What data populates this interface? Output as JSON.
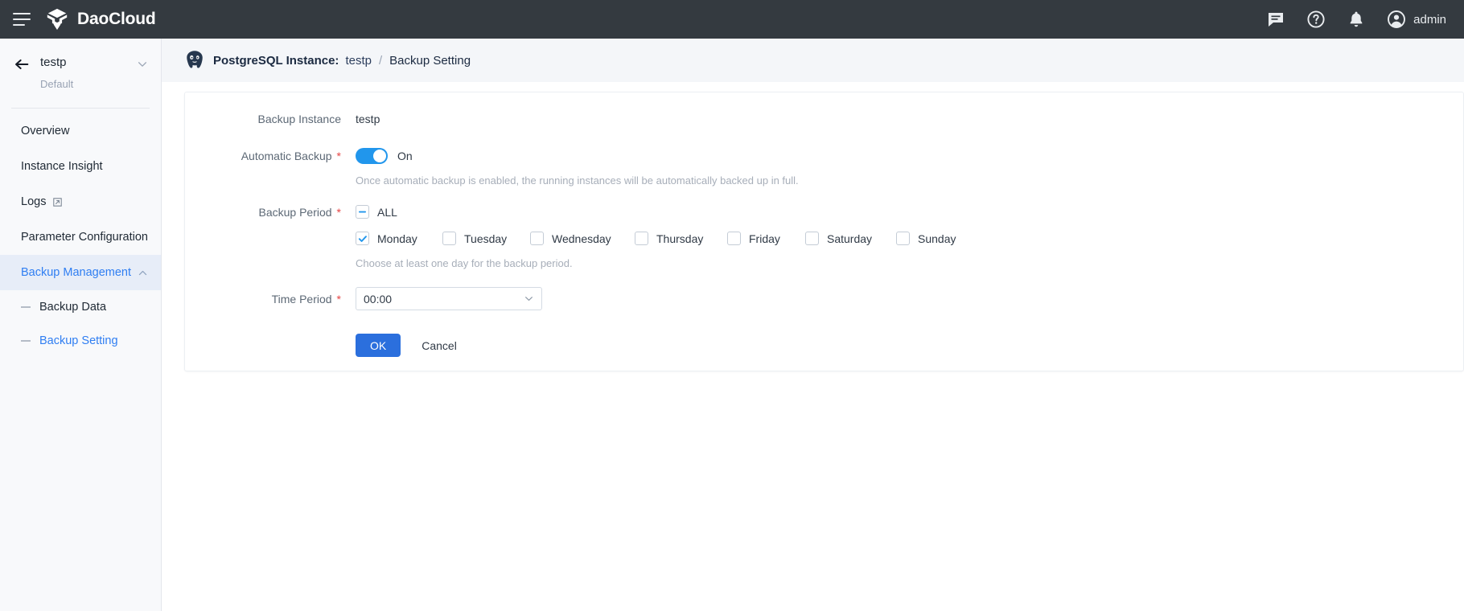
{
  "topbar": {
    "menu_icon": "hamburger-icon",
    "brand": "DaoCloud",
    "icons": [
      "message-icon",
      "help-icon",
      "bell-icon"
    ],
    "user": "admin",
    "background": "#343a40"
  },
  "sidebar": {
    "back_icon": "back-arrow-icon",
    "instance": "testp",
    "namespace": "Default",
    "collapse_icon": "chevron-down-icon",
    "items": [
      {
        "label": "Overview",
        "type": "link",
        "active": false
      },
      {
        "label": "Instance Insight",
        "type": "link",
        "active": false
      },
      {
        "label": "Logs",
        "type": "link",
        "active": false,
        "icon": "external-link-icon"
      },
      {
        "label": "Parameter Configuration",
        "type": "link",
        "active": false
      },
      {
        "label": "Backup Management",
        "type": "group",
        "active": true,
        "icon": "chevron-up-icon"
      }
    ],
    "children": [
      {
        "label": "Backup Data",
        "active": false
      },
      {
        "label": "Backup Setting",
        "active": true
      }
    ],
    "accent": "#2f7ef2"
  },
  "breadcrumb": {
    "icon": "postgresql-logo-icon",
    "title": "PostgreSQL Instance:",
    "instance": "testp",
    "separator": "/",
    "current": "Backup Setting"
  },
  "form": {
    "backup_instance": {
      "label": "Backup Instance",
      "value": "testp"
    },
    "automatic_backup": {
      "label": "Automatic Backup",
      "required": "*",
      "state": "On",
      "enabled": true,
      "hint": "Once automatic backup is enabled, the running instances will be automatically backed up in full.",
      "accent": "#2196ec"
    },
    "backup_period": {
      "label": "Backup Period",
      "required": "*",
      "all_label": "ALL",
      "all_state": "indeterminate",
      "hint": "Choose at least one day for the backup period.",
      "days": [
        {
          "label": "Monday",
          "checked": true
        },
        {
          "label": "Tuesday",
          "checked": false
        },
        {
          "label": "Wednesday",
          "checked": false
        },
        {
          "label": "Thursday",
          "checked": false
        },
        {
          "label": "Friday",
          "checked": false
        },
        {
          "label": "Saturday",
          "checked": false
        },
        {
          "label": "Sunday",
          "checked": false
        }
      ]
    },
    "time_period": {
      "label": "Time Period",
      "required": "*",
      "value": "00:00",
      "icon": "chevron-down-icon"
    },
    "actions": {
      "ok": "OK",
      "cancel": "Cancel",
      "ok_color": "#2b6fdd"
    }
  }
}
